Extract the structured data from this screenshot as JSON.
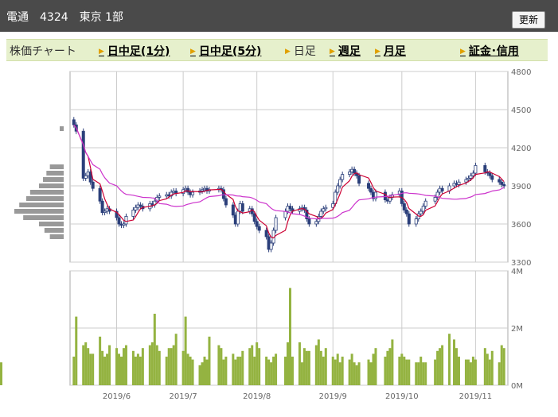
{
  "header": {
    "title": "電通　4324　東京 1部",
    "refresh_label": "更新"
  },
  "tabs": {
    "label": "株価チャート",
    "items": [
      {
        "label": "日中足(1分)",
        "active": false
      },
      {
        "label": "日中足(5分)",
        "active": false
      },
      {
        "label": "日足",
        "active": true
      },
      {
        "label": "週足",
        "active": false
      },
      {
        "label": "月足",
        "active": false
      },
      {
        "label": "証金･信用",
        "active": false
      }
    ]
  },
  "colors": {
    "candle_up": "#ffffff",
    "candle_down": "#2b3f7a",
    "ma_short": "#cc0033",
    "ma_long": "#cc33cc",
    "volume_bar": "#94b341",
    "volume_profile": "#999999",
    "grid": "#cccccc"
  },
  "chart_data": [
    {
      "type": "candlestick",
      "ylim": [
        3300,
        4800
      ],
      "yticks": [
        "4800",
        "4500",
        "4200",
        "3900",
        "3600",
        "3300"
      ],
      "xticks": [
        {
          "label": "2019/6",
          "date": "2019-06-03"
        },
        {
          "label": "2019/7",
          "date": "2019-07-01"
        },
        {
          "label": "2019/8",
          "date": "2019-08-01"
        },
        {
          "label": "2019/9",
          "date": "2019-09-02"
        },
        {
          "label": "2019/10",
          "date": "2019-10-01"
        },
        {
          "label": "2019/11",
          "date": "2019-11-01"
        }
      ],
      "dates": [
        "2019-05-16",
        "2019-05-17",
        "2019-05-20",
        "2019-05-21",
        "2019-05-22",
        "2019-05-23",
        "2019-05-24",
        "2019-05-27",
        "2019-05-28",
        "2019-05-29",
        "2019-05-30",
        "2019-05-31",
        "2019-06-03",
        "2019-06-04",
        "2019-06-05",
        "2019-06-06",
        "2019-06-07",
        "2019-06-10",
        "2019-06-11",
        "2019-06-12",
        "2019-06-13",
        "2019-06-14",
        "2019-06-17",
        "2019-06-18",
        "2019-06-19",
        "2019-06-20",
        "2019-06-21",
        "2019-06-24",
        "2019-06-25",
        "2019-06-26",
        "2019-06-27",
        "2019-06-28",
        "2019-07-01",
        "2019-07-02",
        "2019-07-03",
        "2019-07-04",
        "2019-07-05",
        "2019-07-08",
        "2019-07-09",
        "2019-07-10",
        "2019-07-11",
        "2019-07-12",
        "2019-07-16",
        "2019-07-17",
        "2019-07-18",
        "2019-07-19",
        "2019-07-22",
        "2019-07-23",
        "2019-07-24",
        "2019-07-25",
        "2019-07-26",
        "2019-07-29",
        "2019-07-30",
        "2019-07-31",
        "2019-08-01",
        "2019-08-02",
        "2019-08-05",
        "2019-08-06",
        "2019-08-07",
        "2019-08-08",
        "2019-08-09",
        "2019-08-13",
        "2019-08-14",
        "2019-08-15",
        "2019-08-16",
        "2019-08-19",
        "2019-08-20",
        "2019-08-21",
        "2019-08-22",
        "2019-08-23",
        "2019-08-26",
        "2019-08-27",
        "2019-08-28",
        "2019-08-29",
        "2019-08-30",
        "2019-09-02",
        "2019-09-03",
        "2019-09-04",
        "2019-09-05",
        "2019-09-06",
        "2019-09-09",
        "2019-09-10",
        "2019-09-11",
        "2019-09-12",
        "2019-09-13",
        "2019-09-17",
        "2019-09-18",
        "2019-09-19",
        "2019-09-20",
        "2019-09-24",
        "2019-09-25",
        "2019-09-26",
        "2019-09-27",
        "2019-09-30",
        "2019-10-01",
        "2019-10-02",
        "2019-10-03",
        "2019-10-04",
        "2019-10-07",
        "2019-10-08",
        "2019-10-09",
        "2019-10-10",
        "2019-10-11",
        "2019-10-15",
        "2019-10-16",
        "2019-10-17",
        "2019-10-18",
        "2019-10-21",
        "2019-10-23",
        "2019-10-24",
        "2019-10-25",
        "2019-10-28",
        "2019-10-29",
        "2019-10-30",
        "2019-10-31",
        "2019-11-01",
        "2019-11-05",
        "2019-11-06",
        "2019-11-07",
        "2019-11-08",
        "2019-11-11",
        "2019-11-12",
        "2019-11-13"
      ],
      "close": [
        4380,
        4330,
        3960,
        3980,
        4010,
        3930,
        3880,
        3780,
        3690,
        3700,
        3720,
        3700,
        3650,
        3600,
        3590,
        3600,
        3660,
        3710,
        3730,
        3750,
        3740,
        3720,
        3760,
        3750,
        3780,
        3810,
        3820,
        3830,
        3820,
        3850,
        3860,
        3840,
        3870,
        3880,
        3850,
        3830,
        3850,
        3860,
        3870,
        3880,
        3860,
        3870,
        3880,
        3870,
        3800,
        3750,
        3670,
        3600,
        3700,
        3760,
        3700,
        3720,
        3680,
        3620,
        3580,
        3550,
        3500,
        3400,
        3450,
        3550,
        3650,
        3700,
        3740,
        3720,
        3700,
        3720,
        3730,
        3710,
        3640,
        3600,
        3620,
        3660,
        3700,
        3720,
        3730,
        3760,
        3850,
        3900,
        3950,
        3990,
        4010,
        4030,
        4000,
        3980,
        3920,
        3880,
        3850,
        3800,
        3850,
        3790,
        3780,
        3810,
        3830,
        3860,
        3760,
        3710,
        3680,
        3600,
        3640,
        3680,
        3700,
        3740,
        3780,
        3810,
        3850,
        3880,
        3860,
        3900,
        3920,
        3910,
        3930,
        3950,
        3960,
        3980,
        4000,
        4060,
        4010,
        4000,
        3980,
        3950,
        3930,
        3910,
        3900
      ],
      "volume_profile": [
        {
          "price": 3500,
          "length": 0.28
        },
        {
          "price": 3550,
          "length": 0.39
        },
        {
          "price": 3600,
          "length": 0.5
        },
        {
          "price": 3650,
          "length": 0.82
        },
        {
          "price": 3700,
          "length": 1
        },
        {
          "price": 3750,
          "length": 0.9
        },
        {
          "price": 3800,
          "length": 0.76
        },
        {
          "price": 3850,
          "length": 0.68
        },
        {
          "price": 3900,
          "length": 0.5
        },
        {
          "price": 3950,
          "length": 0.42
        },
        {
          "price": 4000,
          "length": 0.35
        },
        {
          "price": 4050,
          "length": 0.28
        },
        {
          "price": 4350,
          "length": 0.08
        }
      ]
    },
    {
      "type": "bar",
      "ylim": [
        0,
        4000000
      ],
      "yticks": [
        "4M",
        "2M",
        "0M"
      ],
      "volume": [
        1000000,
        2400000,
        1400000,
        1500000,
        1300000,
        1100000,
        1100000,
        1700000,
        1200000,
        1000000,
        1100000,
        1400000,
        1300000,
        1100000,
        1000000,
        1300000,
        1400000,
        1200000,
        1000000,
        1100000,
        1000000,
        1300000,
        1400000,
        1500000,
        2500000,
        1400000,
        1200000,
        1000000,
        1300000,
        1300000,
        1400000,
        1800000,
        1200000,
        2400000,
        1100000,
        1000000,
        900000,
        700000,
        800000,
        1000000,
        900000,
        1700000,
        1400000,
        1300000,
        900000,
        1000000,
        1100000,
        900000,
        1000000,
        1000000,
        1200000,
        1300000,
        1400000,
        1000000,
        1500000,
        1300000,
        1000000,
        900000,
        800000,
        1000000,
        1100000,
        1000000,
        1500000,
        3400000,
        1000000,
        1500000,
        800000,
        1300000,
        1200000,
        1200000,
        1400000,
        1600000,
        1200000,
        1000000,
        1300000,
        1000000,
        900000,
        1100000,
        800000,
        1000000,
        900000,
        1100000,
        800000,
        700000,
        800000,
        900000,
        800000,
        1100000,
        1300000,
        1000000,
        1200000,
        1300000,
        1600000,
        1000000,
        1100000,
        1000000,
        900000,
        900000,
        800000,
        800000,
        1000000,
        800000,
        800000,
        900000,
        1200000,
        1300000,
        1400000,
        1800000,
        1600000,
        1300000,
        1000000,
        900000,
        900000,
        800000,
        1000000,
        900000,
        1300000,
        1100000,
        900000,
        1200000,
        800000,
        1400000,
        1300000,
        800000,
        700000
      ]
    }
  ]
}
